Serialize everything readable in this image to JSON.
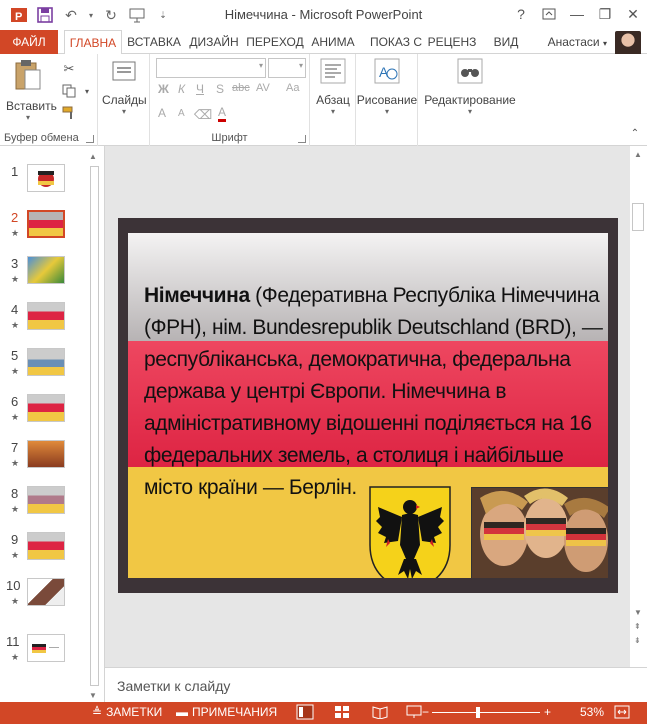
{
  "window": {
    "title": "Німеччина - Microsoft PowerPoint",
    "help": "?",
    "minimize": "—",
    "restore": "❐",
    "close": "✕"
  },
  "qat": {
    "save_icon": "save-icon",
    "undo_icon": "undo-icon",
    "redo_icon": "redo-icon",
    "start_icon": "slideshow-from-start-icon",
    "customize_icon": "customize-arrow-icon"
  },
  "tabs": [
    {
      "label": "ФАЙЛ"
    },
    {
      "label": "ГЛАВНА"
    },
    {
      "label": "ВСТАВКА"
    },
    {
      "label": "ДИЗАЙН"
    },
    {
      "label": "ПЕРЕХОД"
    },
    {
      "label": "АНИМА"
    },
    {
      "label": "ПОКАЗ С"
    },
    {
      "label": "РЕЦЕНЗ"
    },
    {
      "label": "ВИД"
    }
  ],
  "account": {
    "name": "Анастаси"
  },
  "ribbon": {
    "clipboard": {
      "paste_label": "Вставить",
      "group_label": "Буфер обмена"
    },
    "slides": {
      "label": "Слайды"
    },
    "font": {
      "group_label": "Шрифт",
      "bold": "Ж",
      "italic": "К",
      "underline": "Ч",
      "shadow": "S",
      "strike": "abc",
      "spacing": "AV",
      "case": "Aa",
      "grow": "A",
      "shrink": "A",
      "color": "A"
    },
    "paragraph": {
      "label": "Абзац"
    },
    "drawing": {
      "label": "Рисование"
    },
    "editing": {
      "label": "Редактирование"
    }
  },
  "slides_panel": [
    {
      "num": "1",
      "star": ""
    },
    {
      "num": "2",
      "star": "★"
    },
    {
      "num": "3",
      "star": "★"
    },
    {
      "num": "4",
      "star": "★"
    },
    {
      "num": "5",
      "star": "★"
    },
    {
      "num": "6",
      "star": "★"
    },
    {
      "num": "7",
      "star": "★"
    },
    {
      "num": "8",
      "star": "★"
    },
    {
      "num": "9",
      "star": "★"
    },
    {
      "num": "10",
      "star": "★"
    },
    {
      "num": "11",
      "star": "★"
    }
  ],
  "slide": {
    "title_bold": "Німеччина",
    "body": " (Федеративна Республіка Німеччина (ФРН), нім. Bundesrepublik Deutschland (BRD), — республіканська, демократична, федеральна держава у центрі Європи. Німеччина в адміністративному відошенні поділяється на 16 федеральних земель, а столиця і найбільше місто країни — Берлін."
  },
  "notes": {
    "placeholder": "Заметки к слайду"
  },
  "statusbar": {
    "notes": "ЗАМЕТКИ",
    "comments": "ПРИМЕЧАНИЯ",
    "zoom_minus": "−",
    "zoom_plus": "+",
    "zoom": "53%",
    "zoom_level": 0.53
  },
  "colors": {
    "accent": "#d24726",
    "flag_black": "#3c3337",
    "flag_red": "#dd2443",
    "flag_gold": "#f1c744"
  }
}
